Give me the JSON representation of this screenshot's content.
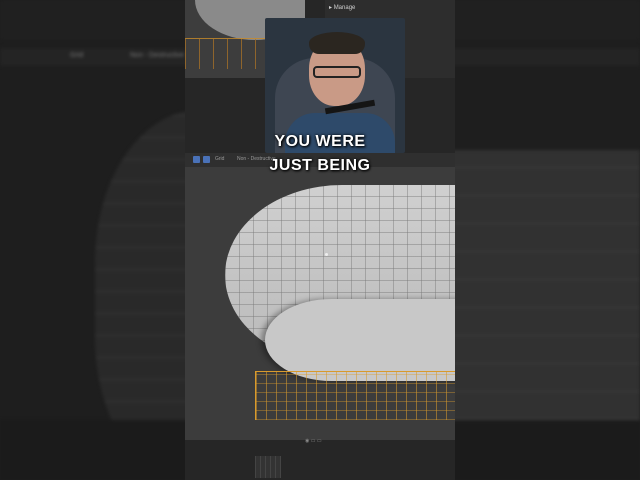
{
  "caption": {
    "line1": "YOU WERE",
    "line2": "JUST BEING"
  },
  "top_panel": {
    "manage_label": "Manage"
  },
  "background_toolbar": {
    "grid_label": "Grid",
    "mode_label": "Non - Destructive"
  },
  "colors": {
    "caption_text": "#ffffff",
    "selection_orange": "#d99a2c",
    "viewport_bg": "#3c3c3c"
  },
  "icons": [
    "play-icon",
    "wireframe-icon",
    "cursor-icon"
  ]
}
